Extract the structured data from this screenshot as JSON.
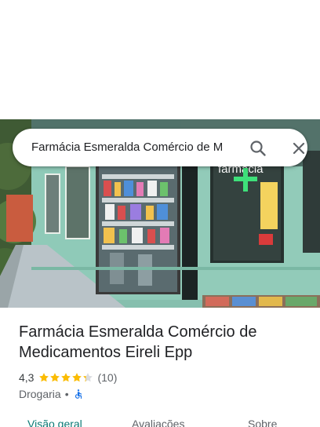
{
  "search": {
    "query": "Farmácia Esmeralda Comércio de M"
  },
  "place": {
    "name": "Farmácia Esmeralda Comércio de Medicamentos Eireli Epp",
    "rating": "4,3",
    "rating_value": 4.3,
    "review_count": "(10)",
    "category": "Drogaria",
    "separator": "•"
  },
  "photo": {
    "sign_text": "farmácia"
  },
  "tabs": [
    {
      "label": "Visão geral",
      "active": true
    },
    {
      "label": "Avaliações",
      "active": false
    },
    {
      "label": "Sobre",
      "active": false
    }
  ],
  "colors": {
    "accent": "#0b7a75",
    "star": "#fbbc04",
    "star_empty": "#dadce0",
    "wheelchair": "#1a73e8"
  },
  "icons": {
    "search": "search-icon",
    "close": "close-icon",
    "star": "star-icon",
    "accessibility": "wheelchair-icon"
  }
}
